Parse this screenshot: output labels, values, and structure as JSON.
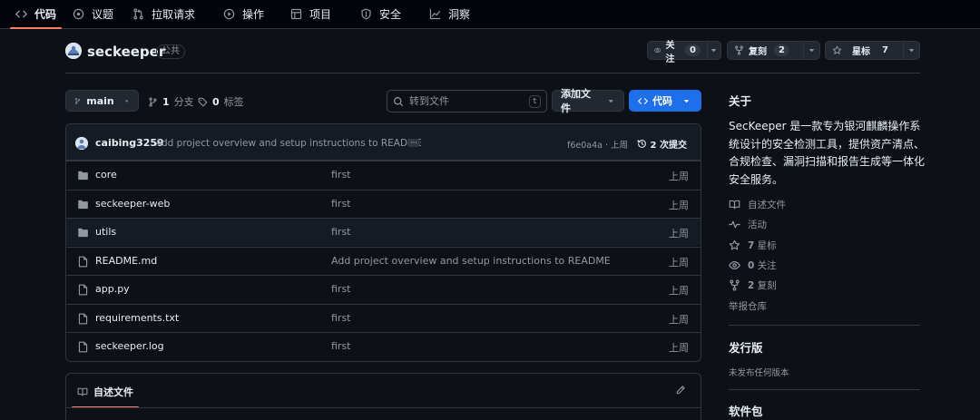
{
  "nav": {
    "tabs": [
      {
        "label": "代码",
        "icon": "code-icon"
      },
      {
        "label": "议题",
        "icon": "issue-icon"
      },
      {
        "label": "拉取请求",
        "icon": "pull-request-icon"
      },
      {
        "label": "操作",
        "icon": "play-icon"
      },
      {
        "label": "项目",
        "icon": "table-icon"
      },
      {
        "label": "安全",
        "icon": "shield-icon"
      },
      {
        "label": "洞察",
        "icon": "graph-icon"
      }
    ]
  },
  "repo": {
    "name": "seckeeper",
    "visibility": "公共",
    "watch": {
      "label": "关注",
      "count": "0"
    },
    "fork": {
      "label": "复刻",
      "count": "2"
    },
    "star": {
      "label": "星标",
      "count": "7"
    }
  },
  "toolbar": {
    "branch": "main",
    "branches_count": "1",
    "branches_label": "分支",
    "tags_count": "0",
    "tags_label": "标签",
    "search_placeholder": "转到文件",
    "search_key": "t",
    "add_file": "添加文件",
    "code": "代码"
  },
  "commit": {
    "user": "caibing3259",
    "message": "Add project overview and setup instructions to README",
    "hash": "f6e0a4a · 上周",
    "history": "2 次提交"
  },
  "files": [
    {
      "name": "core",
      "type": "folder",
      "message": "first",
      "time": "上周"
    },
    {
      "name": "seckeeper-web",
      "type": "folder",
      "message": "first",
      "time": "上周"
    },
    {
      "name": "utils",
      "type": "folder",
      "message": "first",
      "time": "上周"
    },
    {
      "name": "README.md",
      "type": "file",
      "message": "Add project overview and setup instructions to README",
      "time": "上周"
    },
    {
      "name": "app.py",
      "type": "file",
      "message": "first",
      "time": "上周"
    },
    {
      "name": "requirements.txt",
      "type": "file",
      "message": "first",
      "time": "上周"
    },
    {
      "name": "seckeeper.log",
      "type": "file",
      "message": "first",
      "time": "上周"
    }
  ],
  "readme": {
    "title": "自述文件"
  },
  "sidebar": {
    "about_title": "关于",
    "description": "SecKeeper 是一款专为银河麒麟操作系统设计的安全检测工具，提供资产清点、合规检查、漏洞扫描和报告生成等一体化安全服务。",
    "items": [
      {
        "icon": "book-icon",
        "count": "",
        "label": "自述文件"
      },
      {
        "icon": "pulse-icon",
        "count": "",
        "label": "活动"
      },
      {
        "icon": "star-icon",
        "count": "7",
        "label": "星标"
      },
      {
        "icon": "eye-icon",
        "count": "0",
        "label": "关注"
      },
      {
        "icon": "fork-icon",
        "count": "2",
        "label": "复刻"
      }
    ],
    "report": "举报仓库",
    "releases_title": "发行版",
    "releases_none": "未发布任何版本",
    "packages_title": "软件包"
  },
  "colors": {
    "accent": "#1f6feb",
    "tab_underline": "#f78166",
    "background": "#0d1117",
    "nav_background": "#010409",
    "border": "#30363d",
    "muted": "#9198a1"
  }
}
